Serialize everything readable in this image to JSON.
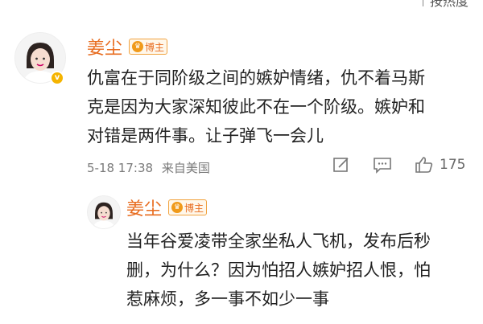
{
  "top_link": {
    "text": "按热度"
  },
  "comment": {
    "author": "姜尘",
    "badge": "博主",
    "text": "仇富在于同阶级之间的嫉妒情绪，仇不着马斯\n克是因为大家深知彼此不在一个阶级。嫉妒和\n对错是两件事。让子弹飞一会儿",
    "date": "5-18 17:38",
    "location": "来自美国",
    "like_count": "175"
  },
  "reply": {
    "author": "姜尘",
    "badge": "博主",
    "text": "当年谷爱凌带全家坐私人飞机，发布后秒\n删，为什么？因为怕招人嫉妒招人恨，怕\n惹麻烦，多一事不如少一事"
  }
}
